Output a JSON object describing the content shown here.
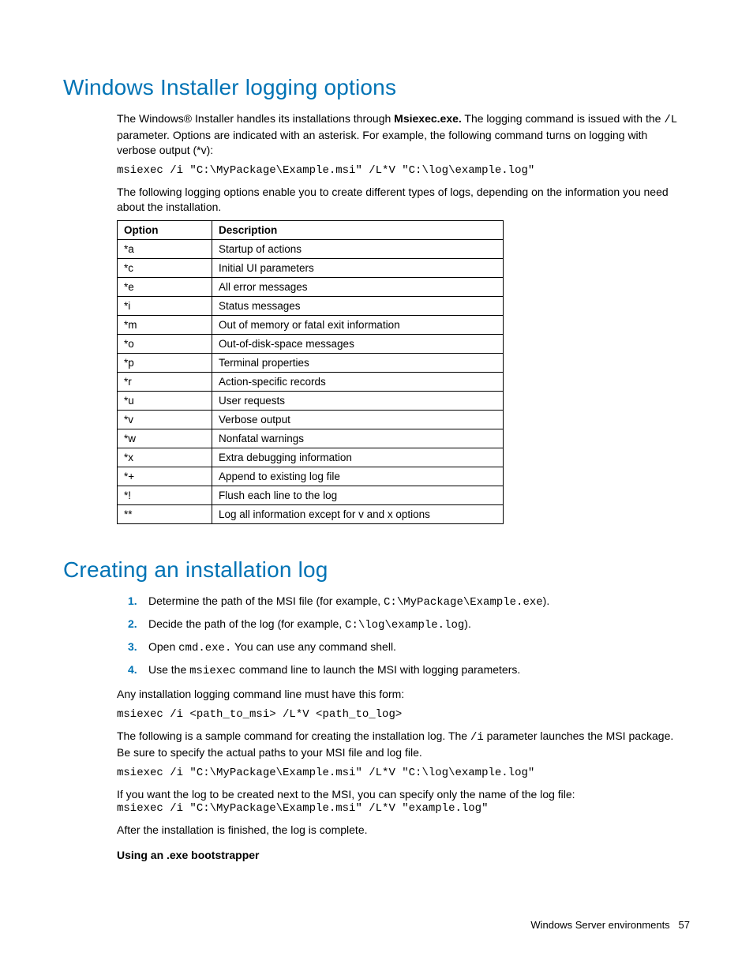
{
  "section1": {
    "heading": "Windows Installer logging options",
    "intro_part1": "The Windows® Installer handles its installations through ",
    "intro_bold": "Msiexec.exe.",
    "intro_part2": " The logging command is issued with the ",
    "intro_code": "/L",
    "intro_part3": " parameter. Options are indicated with an asterisk. For example, the following command turns on logging with verbose output (*v):",
    "code1": "msiexec /i \"C:\\MyPackage\\Example.msi\" /L*V \"C:\\log\\example.log\"",
    "followup": "The following logging options enable you to create different types of logs, depending on the information you need about the installation.",
    "table_h1": "Option",
    "table_h2": "Description",
    "rows": [
      {
        "opt": "*a",
        "desc": "Startup of actions"
      },
      {
        "opt": "*c",
        "desc": "Initial UI parameters"
      },
      {
        "opt": "*e",
        "desc": "All error messages"
      },
      {
        "opt": "*i",
        "desc": "Status messages"
      },
      {
        "opt": "*m",
        "desc": "Out of memory or fatal exit information"
      },
      {
        "opt": "*o",
        "desc": "Out-of-disk-space messages"
      },
      {
        "opt": "*p",
        "desc": "Terminal properties"
      },
      {
        "opt": "*r",
        "desc": "Action-specific records"
      },
      {
        "opt": "*u",
        "desc": "User requests"
      },
      {
        "opt": "*v",
        "desc": "Verbose output"
      },
      {
        "opt": "*w",
        "desc": "Nonfatal warnings"
      },
      {
        "opt": "*x",
        "desc": "Extra debugging information"
      },
      {
        "opt": "*+",
        "desc": "Append to existing log file"
      },
      {
        "opt": "*!",
        "desc": "Flush each line to the log"
      },
      {
        "opt": "**",
        "desc": "Log all information except for v and x options"
      }
    ]
  },
  "section2": {
    "heading": "Creating an installation log",
    "steps": [
      {
        "pre": "Determine the path of the MSI file (for example, ",
        "code": "C:\\MyPackage\\Example.exe",
        "post": ")."
      },
      {
        "pre": "Decide the path of the log (for example, ",
        "code": "C:\\log\\example.log",
        "post": ")."
      },
      {
        "pre": "Open ",
        "code": "cmd.exe.",
        "post": " You can use any command shell."
      },
      {
        "pre": "Use the ",
        "code": "msiexec",
        "post": " command line to launch the MSI with logging parameters."
      }
    ],
    "form_intro": "Any installation logging command line must have this form:",
    "form_code": "msiexec /i <path_to_msi> /L*V <path_to_log>",
    "sample_p1": "The following is a sample command for creating the installation log. The ",
    "sample_code": "/i",
    "sample_p2": " parameter launches the MSI package. Be sure to specify the actual paths to your MSI file and log file.",
    "sample_line": "msiexec /i \"C:\\MyPackage\\Example.msi\" /L*V \"C:\\log\\example.log\"",
    "next_to_msi": "If you want the log to be created next to the MSI, you can specify only the name of the log file:",
    "next_to_msi_code": "msiexec /i \"C:\\MyPackage\\Example.msi\" /L*V \"example.log\"",
    "after": "After the installation is finished, the log is complete.",
    "subhead": "Using an .exe bootstrapper"
  },
  "footer": {
    "text": "Windows Server environments",
    "page": "57"
  }
}
